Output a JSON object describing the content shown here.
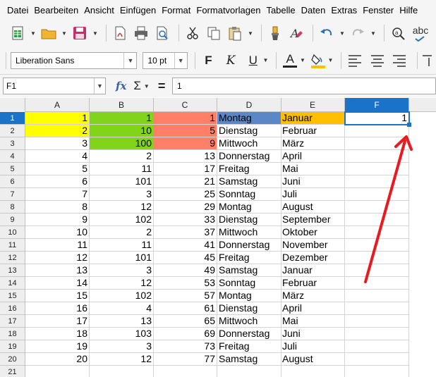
{
  "menu": [
    "Datei",
    "Bearbeiten",
    "Ansicht",
    "Einfügen",
    "Format",
    "Formatvorlagen",
    "Tabelle",
    "Daten",
    "Extras",
    "Fenster",
    "Hilfe"
  ],
  "format_toolbar": {
    "font_name": "Liberation Sans",
    "font_size": "10 pt",
    "bold": "F",
    "italic": "K",
    "underline": "U",
    "font_color_letter": "A"
  },
  "toolbar": {
    "spellcheck_label": "abc"
  },
  "formula_bar": {
    "name_box": "F1",
    "fx": "fx",
    "sigma": "Σ",
    "equals": "=",
    "content": "1"
  },
  "columns": [
    "A",
    "B",
    "C",
    "D",
    "E",
    "F"
  ],
  "active_column": "F",
  "active_row": "1",
  "rows": [
    {
      "n": "1",
      "A": "1",
      "B": "1",
      "C": "1",
      "D": "Montag",
      "E": "Januar",
      "F": "1"
    },
    {
      "n": "2",
      "A": "2",
      "B": "10",
      "C": "5",
      "D": "Dienstag",
      "E": "Februar",
      "F": ""
    },
    {
      "n": "3",
      "A": "3",
      "B": "100",
      "C": "9",
      "D": "Mittwoch",
      "E": "März",
      "F": ""
    },
    {
      "n": "4",
      "A": "4",
      "B": "2",
      "C": "13",
      "D": "Donnerstag",
      "E": "April",
      "F": ""
    },
    {
      "n": "5",
      "A": "5",
      "B": "11",
      "C": "17",
      "D": "Freitag",
      "E": "Mai",
      "F": ""
    },
    {
      "n": "6",
      "A": "6",
      "B": "101",
      "C": "21",
      "D": "Samstag",
      "E": "Juni",
      "F": ""
    },
    {
      "n": "7",
      "A": "7",
      "B": "3",
      "C": "25",
      "D": "Sonntag",
      "E": "Juli",
      "F": ""
    },
    {
      "n": "8",
      "A": "8",
      "B": "12",
      "C": "29",
      "D": "Montag",
      "E": "August",
      "F": ""
    },
    {
      "n": "9",
      "A": "9",
      "B": "102",
      "C": "33",
      "D": "Dienstag",
      "E": "September",
      "F": ""
    },
    {
      "n": "10",
      "A": "10",
      "B": "2",
      "C": "37",
      "D": "Mittwoch",
      "E": "Oktober",
      "F": ""
    },
    {
      "n": "11",
      "A": "11",
      "B": "11",
      "C": "41",
      "D": "Donnerstag",
      "E": "November",
      "F": ""
    },
    {
      "n": "12",
      "A": "12",
      "B": "101",
      "C": "45",
      "D": "Freitag",
      "E": "Dezember",
      "F": ""
    },
    {
      "n": "13",
      "A": "13",
      "B": "3",
      "C": "49",
      "D": "Samstag",
      "E": "Januar",
      "F": ""
    },
    {
      "n": "14",
      "A": "14",
      "B": "12",
      "C": "53",
      "D": "Sonntag",
      "E": "Februar",
      "F": ""
    },
    {
      "n": "15",
      "A": "15",
      "B": "102",
      "C": "57",
      "D": "Montag",
      "E": "März",
      "F": ""
    },
    {
      "n": "16",
      "A": "16",
      "B": "4",
      "C": "61",
      "D": "Dienstag",
      "E": "April",
      "F": ""
    },
    {
      "n": "17",
      "A": "17",
      "B": "13",
      "C": "65",
      "D": "Mittwoch",
      "E": "Mai",
      "F": ""
    },
    {
      "n": "18",
      "A": "18",
      "B": "103",
      "C": "69",
      "D": "Donnerstag",
      "E": "Juni",
      "F": ""
    },
    {
      "n": "19",
      "A": "19",
      "B": "3",
      "C": "73",
      "D": "Freitag",
      "E": "Juli",
      "F": ""
    },
    {
      "n": "20",
      "A": "20",
      "B": "12",
      "C": "77",
      "D": "Samstag",
      "E": "August",
      "F": ""
    },
    {
      "n": "21",
      "A": "",
      "B": "",
      "C": "",
      "D": "",
      "E": "",
      "F": ""
    }
  ],
  "cell_colors": {
    "A1:A2": "#ffff00",
    "B1:B3": "#81d41a",
    "C1:C3": "#ff8066",
    "D1": "#5b87c6",
    "E1": "#ffbf00"
  },
  "colors": {
    "selection": "#1a73c8",
    "annotation_arrow": "#e8191f"
  }
}
